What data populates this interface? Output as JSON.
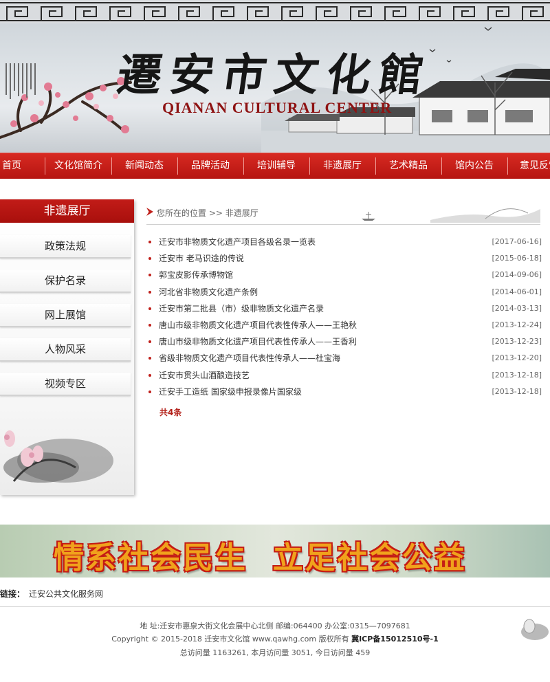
{
  "header": {
    "title": "遷安市文化館",
    "subtitle": "QIANAN CULTURAL CENTER"
  },
  "nav": {
    "items": [
      "首页",
      "文化馆简介",
      "新闻动态",
      "品牌活动",
      "培训辅导",
      "非遗展厅",
      "艺术精品",
      "馆内公告",
      "意见反馈"
    ]
  },
  "sidebar": {
    "heading": "非遗展厅",
    "items": [
      "政策法规",
      "保护名录",
      "网上展馆",
      "人物风采",
      "视频专区"
    ]
  },
  "breadcrumb": {
    "text": "您所在的位置 >> 非遗展厅"
  },
  "articles": [
    {
      "title": "迁安市非物质文化遗产项目各级名录一览表",
      "date": "[2017-06-16]"
    },
    {
      "title": "迁安市 老马识途的传说",
      "date": "[2015-06-18]"
    },
    {
      "title": "郭宝皮影传承博物馆",
      "date": "[2014-09-06]"
    },
    {
      "title": "河北省非物质文化遗产条例",
      "date": "[2014-06-01]"
    },
    {
      "title": "迁安市第二批县（市）级非物质文化遗产名录",
      "date": "[2014-03-13]"
    },
    {
      "title": "唐山市级非物质文化遗产项目代表性传承人——王艳秋",
      "date": "[2013-12-24]"
    },
    {
      "title": "唐山市级非物质文化遗产项目代表性传承人——王香利",
      "date": "[2013-12-23]"
    },
    {
      "title": "省级非物质文化遗产项目代表性传承人——杜宝海",
      "date": "[2013-12-20]"
    },
    {
      "title": "迁安市贯头山酒酿造技艺",
      "date": "[2013-12-18]"
    },
    {
      "title": "迁安手工造纸 国家级申报录像片国家级",
      "date": "[2013-12-18]"
    }
  ],
  "total": "共4条",
  "slogan": "情系社会民生  立足社会公益",
  "links": {
    "label": "链接：",
    "items": [
      "迁安公共文化服务网"
    ]
  },
  "footer": {
    "address": "地 址:迁安市惠泉大街文化会展中心北侧   邮编:064400   办公室:0315—7097681",
    "copyright": "Copyright © 2015-2018 迁安市文化馆 www.qawhg.com 版权所有",
    "icp": "冀ICP备15012510号-1",
    "visits": "总访问量 1163261, 本月访问量 3051, 今日访问量 459"
  },
  "colors": {
    "nav_red": "#c41e18",
    "accent_red": "#b32019",
    "slogan_gold": "#f0a21c"
  }
}
